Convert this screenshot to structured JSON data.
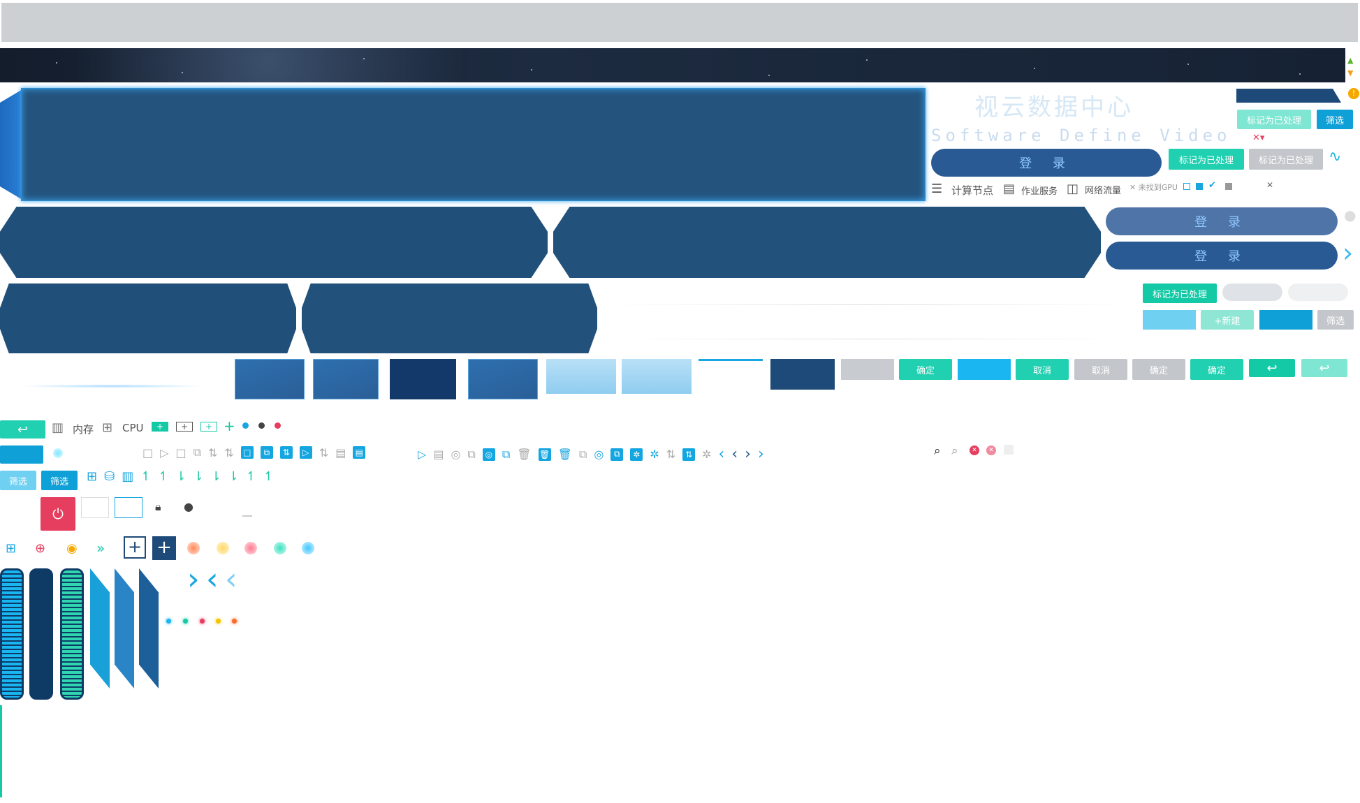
{
  "header": {
    "title": "视云数据中心",
    "subtitle": "Software Define Video"
  },
  "buttons": {
    "mark_processed": "标记为已处理",
    "filter": "筛选",
    "login": "登 录",
    "new": "+新建",
    "confirm": "确定",
    "cancel": "取消"
  },
  "nav": {
    "compute_node": "计算节点",
    "job_service": "作业服务",
    "network_traffic": "网络流量",
    "gpu_not_found": "未找到GPU"
  },
  "resources": {
    "memory": "内存",
    "cpu": "CPU"
  },
  "colors": {
    "teal": "#20d0b0",
    "blue": "#0ea0d6",
    "navy": "#20507a",
    "red": "#e53e5f"
  }
}
